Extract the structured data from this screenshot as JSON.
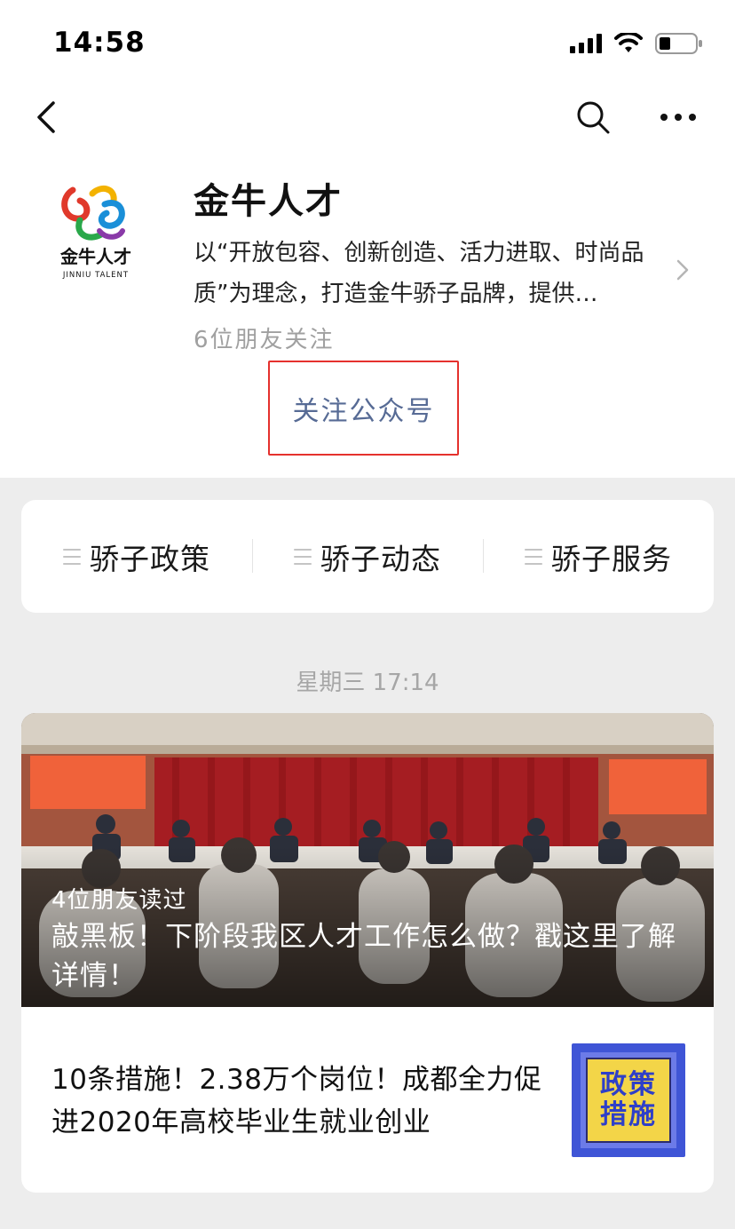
{
  "status_bar": {
    "time": "14:58"
  },
  "account": {
    "logo_text": "金牛人才",
    "logo_subtext": "JINNIU TALENT",
    "name": "金牛人才",
    "description": "以“开放包容、创新创造、活力进取、时尚品质”为理念，打造金牛骄子品牌，提供…",
    "followers": "6位朋友关注",
    "follow_label": "关注公众号"
  },
  "menu": {
    "items": [
      {
        "label": "骄子政策"
      },
      {
        "label": "骄子动态"
      },
      {
        "label": "骄子服务"
      }
    ]
  },
  "feed": {
    "timestamp": "星期三 17:14",
    "main_article": {
      "read_by": "4位朋友读过",
      "title": "敲黑板！下阶段我区人才工作怎么做？戳这里了解详情！"
    },
    "sub_article": {
      "title": "10条措施！2.38万个岗位！成都全力促进2020年高校毕业生就业创业",
      "thumb_line1": "政策",
      "thumb_line2": "措施"
    }
  },
  "colors": {
    "link_blue": "#576b95",
    "highlight_red": "#e5312d",
    "background": "#ededed"
  }
}
